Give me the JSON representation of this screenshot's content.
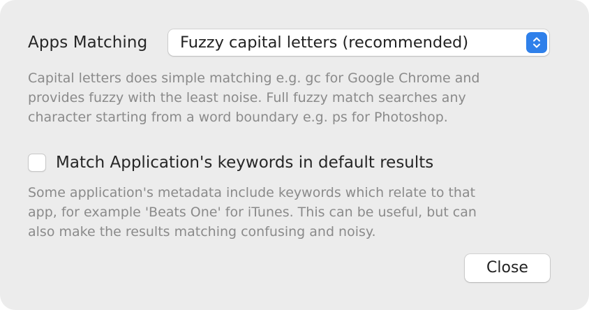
{
  "apps_matching": {
    "label": "Apps Matching",
    "selected": "Fuzzy capital letters (recommended)",
    "description_lines": [
      "Capital letters does simple matching e.g. gc for Google Chrome and",
      "provides fuzzy with the least noise. Full fuzzy match searches any",
      "character starting from a word boundary e.g. ps for Photoshop."
    ]
  },
  "keywords_option": {
    "label": "Match Application's keywords in default results",
    "checked": false,
    "description_lines": [
      "Some application's metadata include keywords which relate to that",
      "app, for example 'Beats One' for iTunes. This can be useful, but can",
      "also make the results matching confusing and noisy."
    ]
  },
  "buttons": {
    "close_label": "Close"
  },
  "colors": {
    "accent": "#2f80ea",
    "dialog_bg": "#ececec",
    "secondary_text": "#8a8a8a"
  },
  "icons": {
    "stepper": "chevron-up-down-icon"
  }
}
